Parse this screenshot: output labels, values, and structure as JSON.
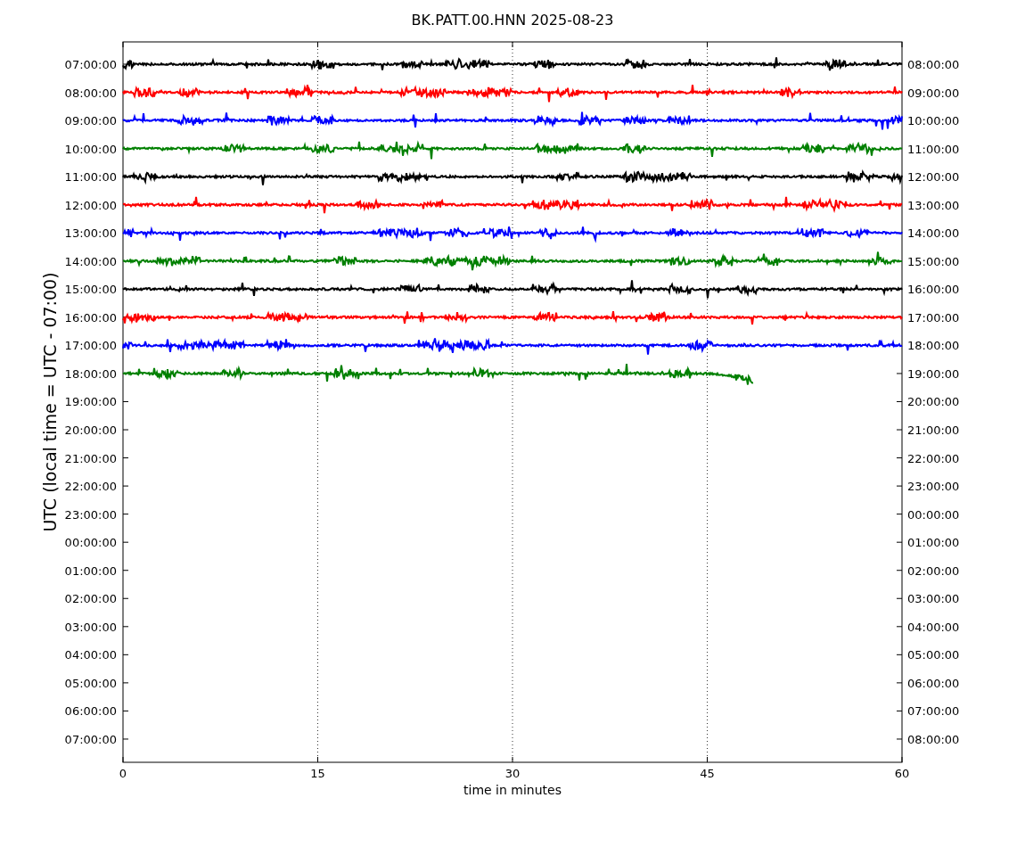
{
  "title": "BK.PATT.00.HNN 2025-08-23",
  "ylabel": "UTC (local time = UTC - 07:00)",
  "xlabel": "time in minutes",
  "x_ticks": [
    "0",
    "15",
    "30",
    "45",
    "60"
  ],
  "left_ticks": [
    "07:00:00",
    "08:00:00",
    "09:00:00",
    "10:00:00",
    "11:00:00",
    "12:00:00",
    "13:00:00",
    "14:00:00",
    "15:00:00",
    "16:00:00",
    "17:00:00",
    "18:00:00",
    "19:00:00",
    "20:00:00",
    "21:00:00",
    "22:00:00",
    "23:00:00",
    "00:00:00",
    "01:00:00",
    "02:00:00",
    "03:00:00",
    "04:00:00",
    "05:00:00",
    "06:00:00",
    "07:00:00"
  ],
  "right_ticks": [
    "08:00:00",
    "09:00:00",
    "10:00:00",
    "11:00:00",
    "12:00:00",
    "13:00:00",
    "14:00:00",
    "15:00:00",
    "16:00:00",
    "17:00:00",
    "18:00:00",
    "19:00:00",
    "20:00:00",
    "21:00:00",
    "22:00:00",
    "23:00:00",
    "00:00:00",
    "01:00:00",
    "02:00:00",
    "03:00:00",
    "04:00:00",
    "05:00:00",
    "06:00:00",
    "07:00:00",
    "08:00:00"
  ],
  "traces": [
    {
      "color": "#000000"
    },
    {
      "color": "#ff0000"
    },
    {
      "color": "#0000ff"
    },
    {
      "color": "#008000"
    },
    {
      "color": "#000000"
    },
    {
      "color": "#ff0000"
    },
    {
      "color": "#0000ff"
    },
    {
      "color": "#008000"
    },
    {
      "color": "#000000"
    },
    {
      "color": "#ff0000"
    },
    {
      "color": "#0000ff"
    },
    {
      "color": "#008000"
    }
  ]
}
